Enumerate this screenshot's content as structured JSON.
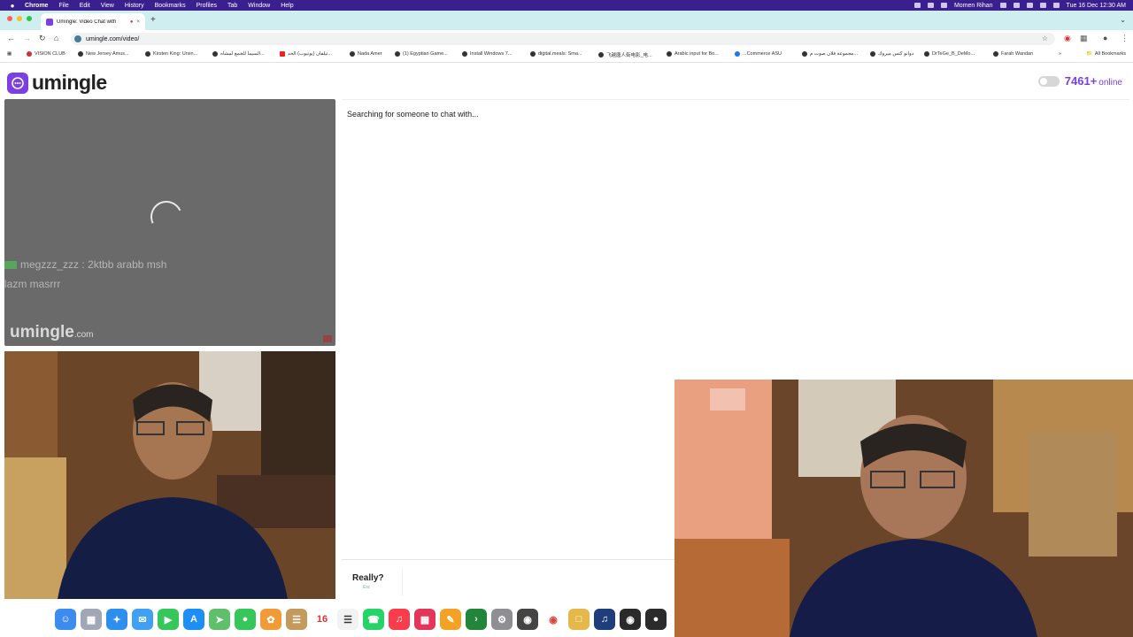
{
  "menubar": {
    "apple_icon": "apple-icon",
    "items": [
      "Chrome",
      "File",
      "Edit",
      "View",
      "History",
      "Bookmarks",
      "Profiles",
      "Tab",
      "Window",
      "Help"
    ],
    "user": "Momen Rihan",
    "clock": "Tue 16 Dec 12:30 AM"
  },
  "tab": {
    "title": "Umingle: Video Chat with",
    "close": "×",
    "new_tab": "+"
  },
  "address": {
    "url": "umingle.com/video/"
  },
  "bookmarks": [
    "VISION CLUB",
    "New Jersey Amus...",
    "Kirsten King: Ursin...",
    "السيما للجمع لمشاه...",
    "تيلفان (يوتيوب) الحد...",
    "Nada Amer",
    "(1) Egyptian Game...",
    "Install Windows 7...",
    "digital.meals: Sma...",
    "飞越唐人街电影_电...",
    "Arabic input for Bo...",
    "...Commerce ASU",
    "مجموعة فلان صوت م...",
    "دوانو كتس ميروك",
    "DrTeGe_B_DeMo...",
    "Farah Wandan"
  ],
  "all_bookmarks": "All Bookmarks",
  "site": {
    "logo_text": "umingle",
    "online_count": "7461+",
    "online_label": "online"
  },
  "partner": {
    "chat_user": "megzzz_zzz",
    "chat_text": ": 2ktbb arabb msh",
    "chat_text2": "lazm masrrr",
    "watermark": "umingle",
    "watermark_suffix": ".com"
  },
  "chat": {
    "status": "Searching for someone to chat with...",
    "stop_label": "Really?",
    "stop_hint": "Esc"
  },
  "dock": {
    "calendar_day": "16",
    "icons": [
      "finder-icon",
      "launchpad-icon",
      "safari-icon",
      "mail-icon",
      "facetime-icon",
      "appstore-icon",
      "maps-icon",
      "messages-icon",
      "photos-icon",
      "notes-icon",
      "calendar-icon",
      "reminders-icon",
      "whatsapp-icon",
      "music-icon",
      "slack-icon",
      "pages-icon",
      "terminal-icon",
      "settings-icon",
      "photobooth-icon",
      "chrome-icon",
      "folder-icon",
      "voice-icon",
      "obs-icon",
      "capture-icon"
    ]
  },
  "colors": {
    "menubar": "#3a1f8f",
    "tabbar": "#cfeef0",
    "accent": "#7b3fe4"
  }
}
